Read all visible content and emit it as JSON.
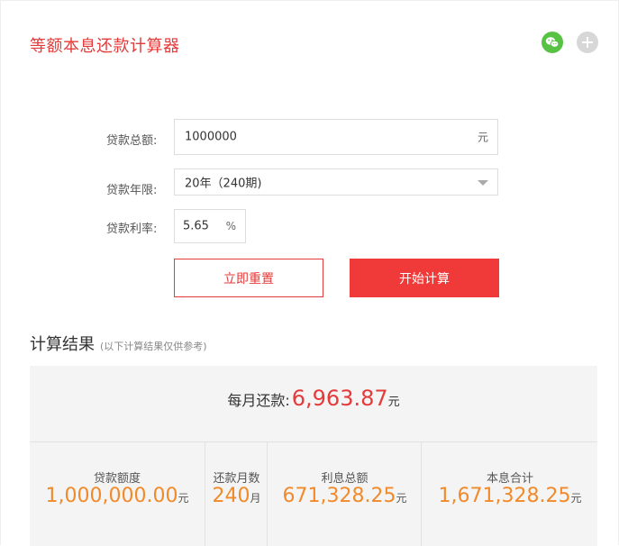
{
  "header": {
    "title": "等额本息还款计算器",
    "icons": [
      "wechat-icon",
      "plus-icon"
    ],
    "colors": {
      "accent": "#e43a3a",
      "wechat": "#57c244",
      "highlight": "#f08a2a"
    }
  },
  "form": {
    "amount_label": "贷款总额:",
    "amount_value": "1000000",
    "amount_unit": "元",
    "term_label": "贷款年限:",
    "term_value": "20年（240期)",
    "rate_label": "贷款利率:",
    "rate_value": "5.65",
    "rate_unit": "%",
    "reset_label": "立即重置",
    "calc_label": "开始计算"
  },
  "result": {
    "title": "计算结果",
    "note": "(以下计算结果仅供参考)",
    "monthly_label": "每月还款:",
    "monthly_value": "6,963.87",
    "monthly_unit": "元",
    "items": [
      {
        "label": "贷款额度",
        "value": "1,000,000.00",
        "unit": "元"
      },
      {
        "label": "还款月数",
        "value": "240",
        "unit": "月"
      },
      {
        "label": "利息总额",
        "value": "671,328.25",
        "unit": "元"
      },
      {
        "label": "本息合计",
        "value": "1,671,328.25",
        "unit": "元"
      }
    ]
  }
}
